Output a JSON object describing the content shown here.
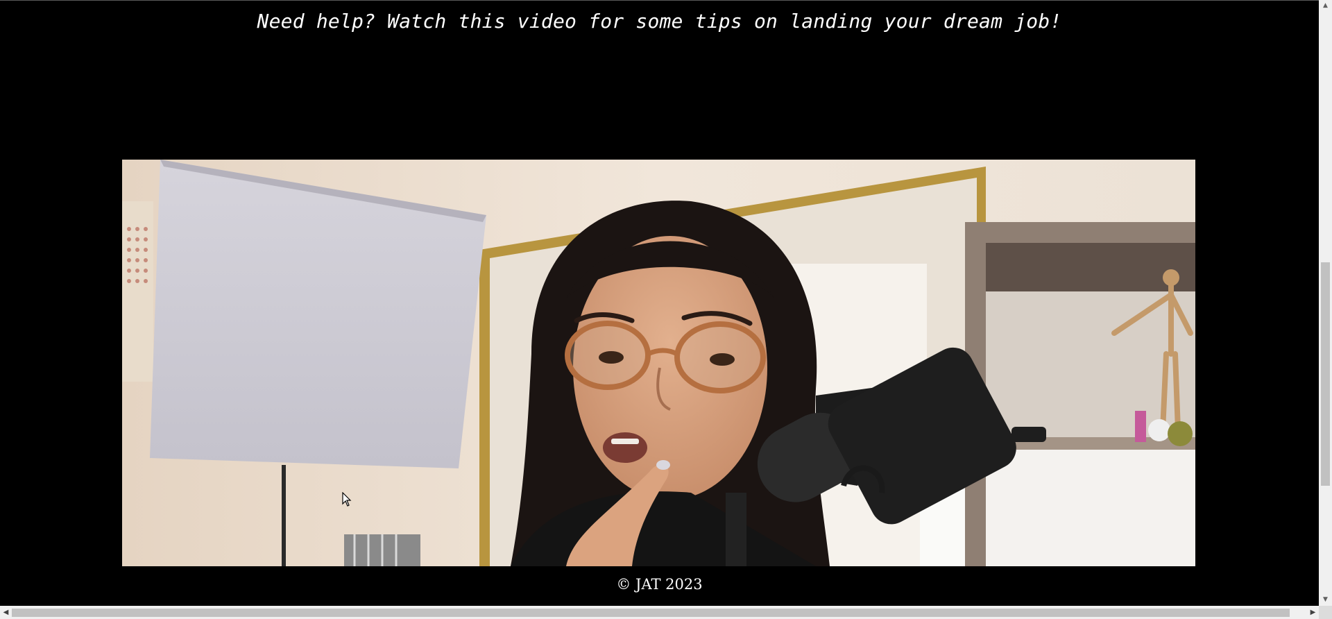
{
  "page": {
    "heading": "Need help? Watch this video for some tips on landing your dream job!",
    "footer": "© JAT 2023"
  },
  "video": {
    "description_icon": "video-player"
  },
  "scrollbars": {
    "vertical_up_icon": "▲",
    "vertical_down_icon": "▼",
    "horizontal_left_icon": "◀",
    "horizontal_right_icon": "▶"
  }
}
